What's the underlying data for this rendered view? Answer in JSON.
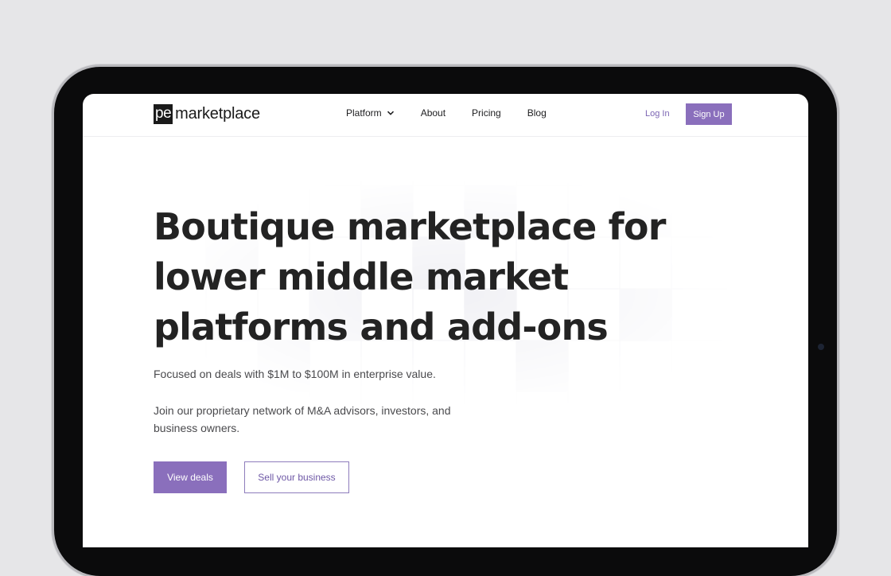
{
  "colors": {
    "accent": "#8a6fbc",
    "heading": "#232323",
    "body_text": "#4a4a4d",
    "device_frame": "#0b0b0c",
    "background": "#e6e6e8"
  },
  "header": {
    "logo_mark": "pe",
    "logo_text": "marketplace",
    "nav": [
      {
        "label": "Platform",
        "icon": "chevron-down-icon"
      },
      {
        "label": "About"
      },
      {
        "label": "Pricing"
      },
      {
        "label": "Blog"
      }
    ],
    "login_label": "Log In",
    "signup_label": "Sign Up"
  },
  "hero": {
    "title_lines": [
      "Boutique marketplace for",
      "lower middle market",
      "platforms and add-ons"
    ],
    "subtitle": "Focused on deals with $1M to $100M in enterprise value.",
    "body": "Join our proprietary network of M&A advisors, investors, and business owners.",
    "primary_cta": "View deals",
    "secondary_cta": "Sell your business"
  }
}
